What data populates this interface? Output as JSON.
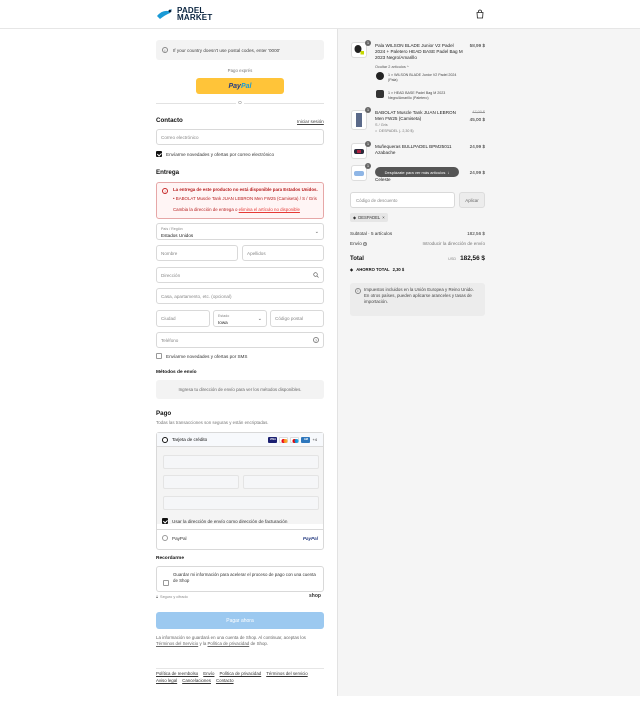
{
  "header": {
    "logo_line1": "PADEL",
    "logo_line2": "MARKET",
    "brand_color": "#0b2540",
    "accent_color": "#1a9ad6",
    "cart_icon": "shopping-bag-icon"
  },
  "notice": {
    "text": "If your country doesn't use postal codes, enter '0000'"
  },
  "express": {
    "label": "Pago exprés",
    "paypal_part1": "Pay",
    "paypal_part2": "Pal",
    "divider": "O"
  },
  "contact": {
    "title": "Contacto",
    "login_link": "Iniciar sesión",
    "email_placeholder": "Correo electrónico",
    "newsletter_label": "Envíarme novedades y ofertas por correo electrónico"
  },
  "delivery": {
    "title": "Entrega",
    "error_title": "La entrega de este producto no está disponible para Estados Unidos.",
    "error_item": "BABOLAT Muscle Tank JUAN LEBRON Men FW25 (Camiseta) / S / Gris",
    "error_hint_prefix": "Cambia la dirección de entrega o ",
    "error_hint_link": "elimina el artículo no disponible",
    "country_label": "País / Región",
    "country_value": "Estados Unidos",
    "first_name": "Nombre",
    "last_name": "Apellidos",
    "address": "Dirección",
    "apartment": "Casa, apartamento, etc. (opcional)",
    "city": "Ciudad",
    "state_label": "Estado",
    "state_value": "Iowa",
    "zip": "Código postal",
    "phone": "Teléfono",
    "sms_label": "Envíarme novedades y ofertas por SMS"
  },
  "shipping": {
    "title": "Métodos de envío",
    "placeholder": "Ingresa tu dirección de envío para ver los métodos disponibles."
  },
  "payment": {
    "title": "Pago",
    "subtitle": "Todas las transacciones son seguras y están encriptadas.",
    "card_label": "Tarjeta de crédito",
    "more_cards": "+4",
    "billing_label": "Usar la dirección de envío como dirección de facturación",
    "paypal_label": "PayPal",
    "paypal_logo": "PayPal"
  },
  "remember": {
    "title": "Recordarme",
    "text": "Guardar mi información para acelerar el proceso de pago con una cuenta de Shop",
    "secure": "Seguro y cifrado",
    "shop_logo": "shop"
  },
  "pay_now": "Pagar ahora",
  "legal": {
    "prefix": "La información se guardará en una cuenta de Shop. Al continuar, aceptas los ",
    "terms": "Términos del Servicio",
    "middle": " y la ",
    "privacy": "Política de privacidad",
    "suffix": " de Shop."
  },
  "footer_links": [
    "Política de reembolso",
    "Envío",
    "Política de privacidad",
    "Términos del servicio",
    "Aviso legal",
    "Cancelaciones",
    "Contacto"
  ],
  "cart": {
    "items": [
      {
        "qty": "1",
        "name": "Pala WILSON BLADE Junior V2 Padel 2024 + Paletero HEAD BASE Padel Bag M 2023 Negro/Amarillo",
        "price": "58,99 $",
        "bundle_label": "Ocultar 2 artículos",
        "sub1": "1 × WILSON BLADE Junior V2 Padel 2024 (Pala)",
        "sub2": "1 × HEAD BASE Padel Bag M 2023 Negro/Amarillo (Paletero)"
      },
      {
        "qty": "1",
        "name": "BABOLAT Muscle Tank JUAN LEBRON Men FW25 (Camiseta)",
        "variant": "S / Gris",
        "old_price": "47,00 $",
        "price": "45,00 $",
        "discount": "DESPADEL (- 2,30 $)"
      },
      {
        "qty": "1",
        "name": "Muñequeras BULLPADEL BPM25011 Azabache",
        "price": "24,99 $"
      },
      {
        "qty": "1",
        "name": "Celeste",
        "price": "24,99 $"
      }
    ],
    "scroll_hint": "Desplázate para ver más artículos",
    "discount_placeholder": "Código de descuento",
    "apply": "Aplicar",
    "discount_code": "DESPADEL",
    "subtotal_label": "Subtotal · 5 artículos",
    "subtotal": "182,56 $",
    "shipping_label": "Envío",
    "shipping_value": "Introducir la dirección de envío",
    "total_label": "Total",
    "currency": "USD",
    "total": "182,56 $",
    "savings_label": "AHORRO TOTAL",
    "savings": "2,30 $",
    "tax_note": "Impuestos incluidos en la Unión Europea y Reino Unido. En otros países, pueden aplicarse aranceles y tasas de importación."
  }
}
